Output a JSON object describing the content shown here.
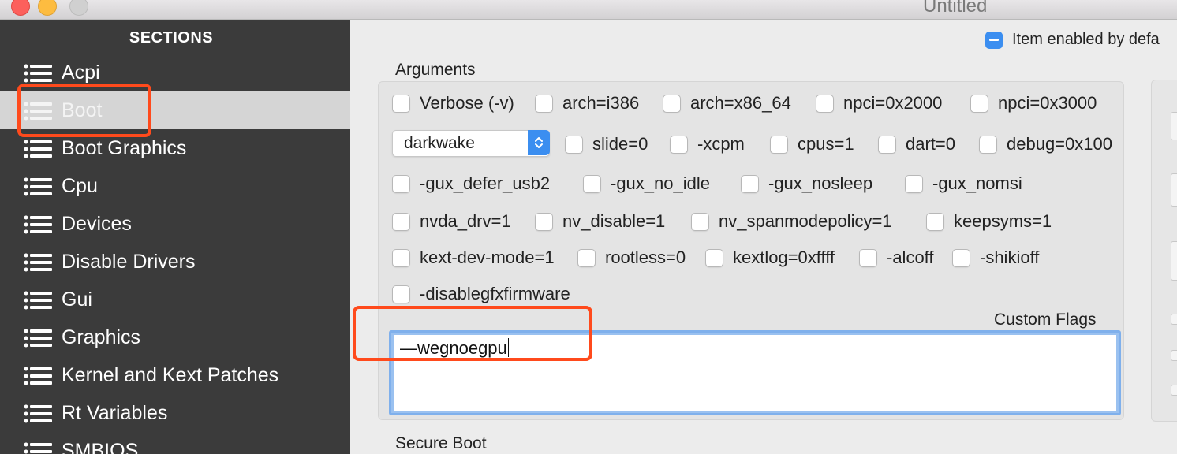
{
  "window": {
    "title": "Untitled"
  },
  "sidebar": {
    "header": "SECTIONS",
    "items": [
      {
        "label": "Acpi"
      },
      {
        "label": "Boot",
        "selected": true
      },
      {
        "label": "Boot Graphics"
      },
      {
        "label": "Cpu"
      },
      {
        "label": "Devices"
      },
      {
        "label": "Disable Drivers"
      },
      {
        "label": "Gui"
      },
      {
        "label": "Graphics"
      },
      {
        "label": "Kernel and Kext Patches"
      },
      {
        "label": "Rt Variables"
      },
      {
        "label": "SMBIOS"
      }
    ]
  },
  "main": {
    "enabled_label": "Item enabled by defa",
    "arguments_label": "Arguments",
    "checkboxes": [
      {
        "label": "Verbose (-v)",
        "checked": false
      },
      {
        "label": "arch=i386",
        "checked": false
      },
      {
        "label": "arch=x86_64",
        "checked": false
      },
      {
        "label": "npci=0x2000",
        "checked": false
      },
      {
        "label": "npci=0x3000",
        "checked": false
      },
      {
        "label": "slide=0",
        "checked": false
      },
      {
        "label": "-xcpm",
        "checked": false
      },
      {
        "label": "cpus=1",
        "checked": false
      },
      {
        "label": "dart=0",
        "checked": false
      },
      {
        "label": "debug=0x100",
        "checked": false
      },
      {
        "label": "-gux_defer_usb2",
        "checked": false
      },
      {
        "label": "-gux_no_idle",
        "checked": false
      },
      {
        "label": "-gux_nosleep",
        "checked": false
      },
      {
        "label": "-gux_nomsi",
        "checked": false
      },
      {
        "label": "nvda_drv=1",
        "checked": false
      },
      {
        "label": "nv_disable=1",
        "checked": false
      },
      {
        "label": "nv_spanmodepolicy=1",
        "checked": false
      },
      {
        "label": "keepsyms=1",
        "checked": false
      },
      {
        "label": "kext-dev-mode=1",
        "checked": false
      },
      {
        "label": "rootless=0",
        "checked": false
      },
      {
        "label": "kextlog=0xffff",
        "checked": false
      },
      {
        "label": "-alcoff",
        "checked": false
      },
      {
        "label": "-shikioff",
        "checked": false
      },
      {
        "label": "-disablegfxfirmware",
        "checked": false
      }
    ],
    "dropdown": {
      "selected": "darkwake"
    },
    "custom_flags_label": "Custom Flags",
    "custom_flags_value": "—wegnoegpu",
    "secure_boot_label": "Secure Boot"
  },
  "colors": {
    "sidebar_bg": "#3b3b3b",
    "accent": "#3b8ef0",
    "annotation": "#ff4a1c"
  },
  "icons": [
    "list-icon",
    "chevron-updown-icon",
    "minus-icon"
  ]
}
